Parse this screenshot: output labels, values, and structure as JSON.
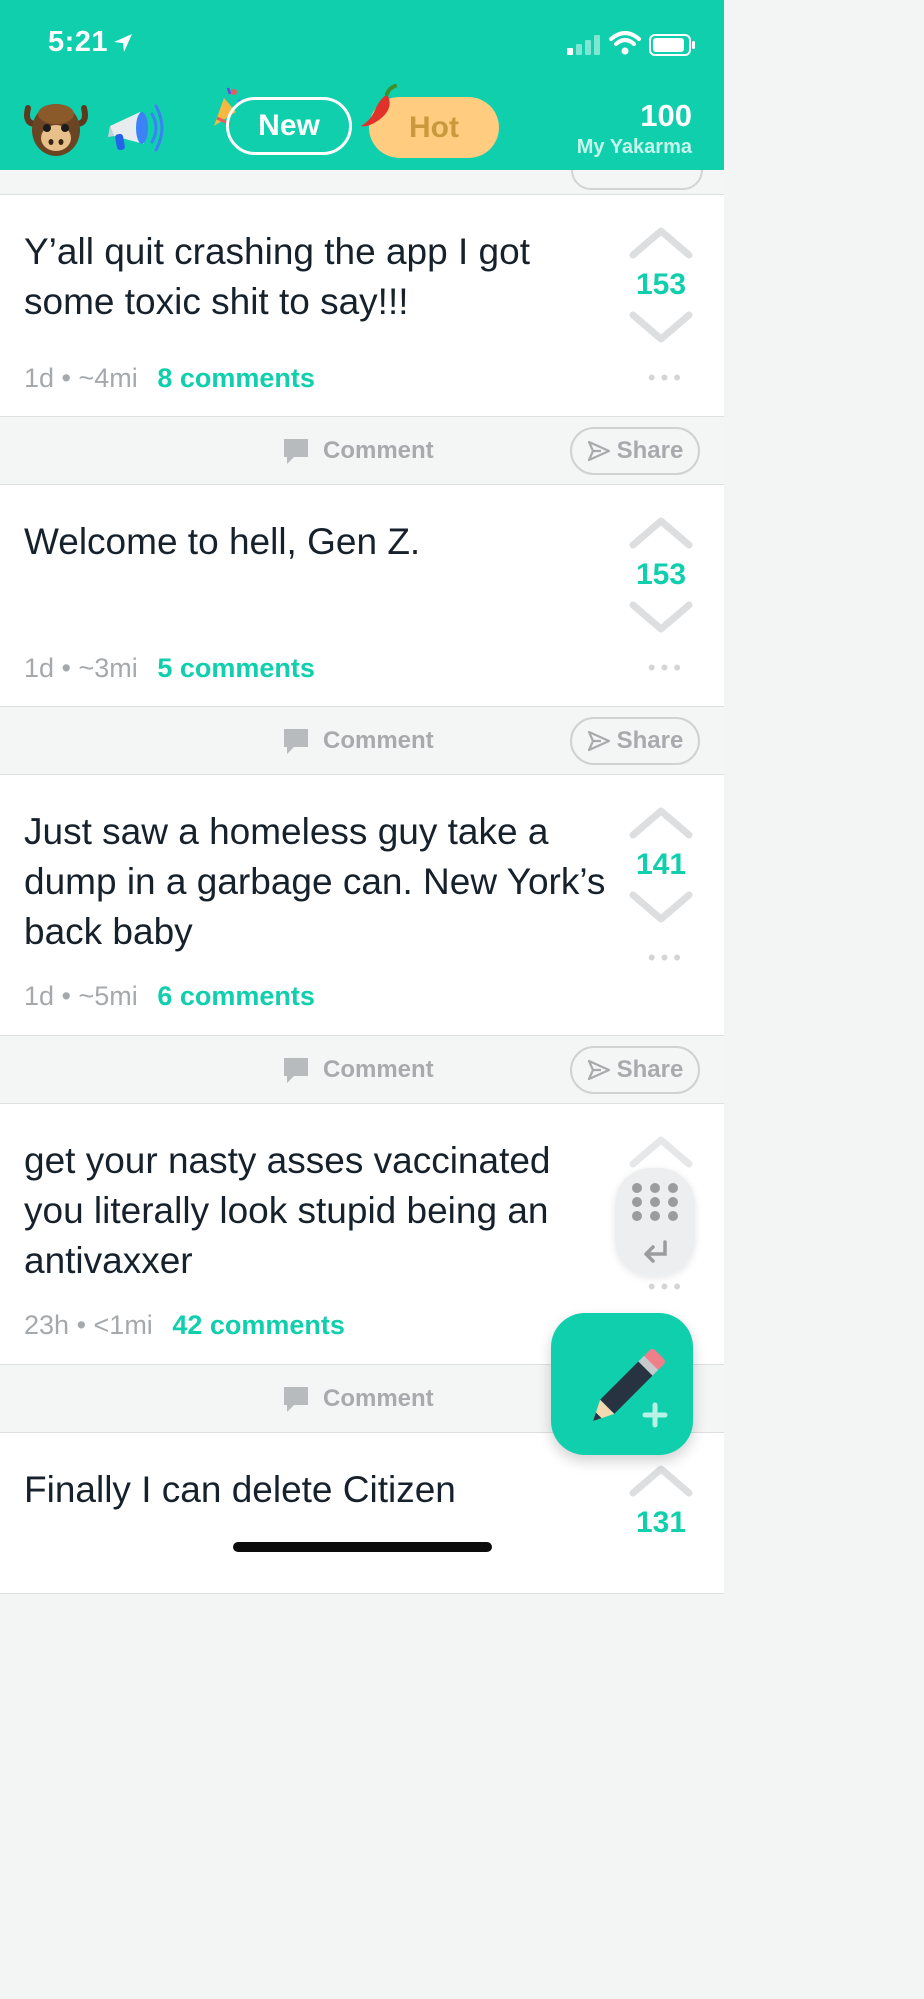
{
  "status_bar": {
    "time": "5:21"
  },
  "header": {
    "tabs": [
      {
        "label": "New"
      },
      {
        "label": "Hot"
      }
    ],
    "karma": {
      "value": "100",
      "label": "My Yakarma"
    }
  },
  "actions": {
    "comment_label": "Comment",
    "share_label": "Share"
  },
  "posts": [
    {
      "text": "Y’all quit crashing the app I got some toxic shit to say!!!",
      "age": "1d",
      "distance": "~4mi",
      "comments": "8 comments",
      "score": "153"
    },
    {
      "text": "Welcome to hell, Gen Z.",
      "age": "1d",
      "distance": "~3mi",
      "comments": "5 comments",
      "score": "153"
    },
    {
      "text": "Just saw a homeless guy take a dump in a garbage can. New York’s back baby",
      "age": "1d",
      "distance": "~5mi",
      "comments": "6 comments",
      "score": "141"
    },
    {
      "text": "get your nasty asses vaccinated you literally look stupid being an antivaxxer",
      "age": "23h",
      "distance": "<1mi",
      "comments": "42 comments",
      "score": ""
    },
    {
      "text": "Finally I can delete Citizen",
      "score": "131"
    }
  ],
  "colors": {
    "brand": "#10cfad",
    "hot_pill": "#ffcc80",
    "text": "#16212b",
    "muted": "#a6a9ac"
  },
  "icons": [
    "location-arrow-icon",
    "signal-icon",
    "wifi-icon",
    "battery-icon",
    "yak-logo-icon",
    "megaphone-icon",
    "confetti-icon",
    "chili-pepper-icon",
    "upvote-icon",
    "downvote-icon",
    "more-dots-icon",
    "comment-bubble-icon",
    "share-paper-plane-icon",
    "keypad-icon",
    "return-arrow-icon",
    "pencil-icon",
    "plus-icon"
  ]
}
